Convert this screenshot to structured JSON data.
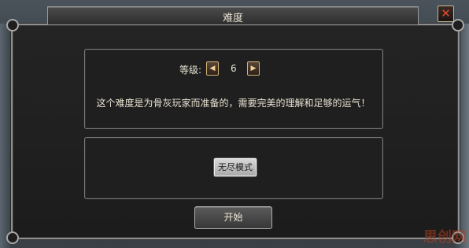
{
  "window": {
    "title": "难度",
    "close_icon": "close-icon"
  },
  "difficulty": {
    "level_label": "等级:",
    "level_value": "6",
    "prev_icon": "chevron-left-icon",
    "next_icon": "chevron-right-icon",
    "description": "这个难度是为骨灰玩家而准备的，需要完美的理解和足够的运气！"
  },
  "mode": {
    "button_label": "无尽模式"
  },
  "actions": {
    "start_label": "开始"
  },
  "watermark": {
    "text": "思创网"
  },
  "colors": {
    "accent_gold": "#d2b27a",
    "close_red": "#e04a2e",
    "text_light": "#e8e2d2"
  }
}
